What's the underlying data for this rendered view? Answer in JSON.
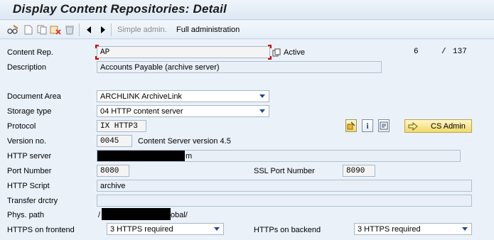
{
  "window": {
    "title": "Display Content Repositories: Detail"
  },
  "toolbar": {
    "icons": [
      "glasses-edit-icon",
      "new-document-icon",
      "copy-icon",
      "delete-table-icon",
      "trash-icon",
      "previous-icon",
      "next-icon"
    ],
    "simple_admin_label": "Simple admin.",
    "full_admin_label": "Full administration"
  },
  "form": {
    "content_rep": {
      "label": "Content Rep.",
      "value": "AP",
      "status": "Active",
      "page_current": "6",
      "page_sep": "/",
      "page_total": "137"
    },
    "description": {
      "label": "Description",
      "value": "Accounts Payable (archive server)"
    },
    "document_area": {
      "label": "Document Area",
      "value": "ARCHLINK ArchiveLink"
    },
    "storage_type": {
      "label": "Storage type",
      "value": "04 HTTP content server"
    },
    "protocol": {
      "label": "Protocol",
      "value": "IX HTTP3"
    },
    "version_no": {
      "label": "Version no.",
      "value": "0045",
      "description": "Content Server version 4.5"
    },
    "http_server": {
      "label": "HTTP server",
      "value_suffix": "m"
    },
    "port_number": {
      "label": "Port Number",
      "value": "8080"
    },
    "ssl_port": {
      "label": "SSL Port Number",
      "value": "8090"
    },
    "http_script": {
      "label": "HTTP Script",
      "value": "archive"
    },
    "transfer_dir": {
      "label": "Transfer drctry",
      "value": ""
    },
    "phys_path": {
      "label": "Phys. path",
      "value_prefix": "/",
      "value_suffix": "obal/"
    },
    "https_frontend": {
      "label": "HTTPS on frontend",
      "value": "3 HTTPS required"
    },
    "https_backend": {
      "label": "HTTPs on backend",
      "value": "3 HTTPS required"
    }
  },
  "buttons": {
    "cs_admin_label": "CS Admin"
  },
  "colors": {
    "background": "#dfebf5",
    "button_yellow": "#f1d96b",
    "required_marker": "#d00000",
    "arrow_blue": "#1d4d8c"
  }
}
